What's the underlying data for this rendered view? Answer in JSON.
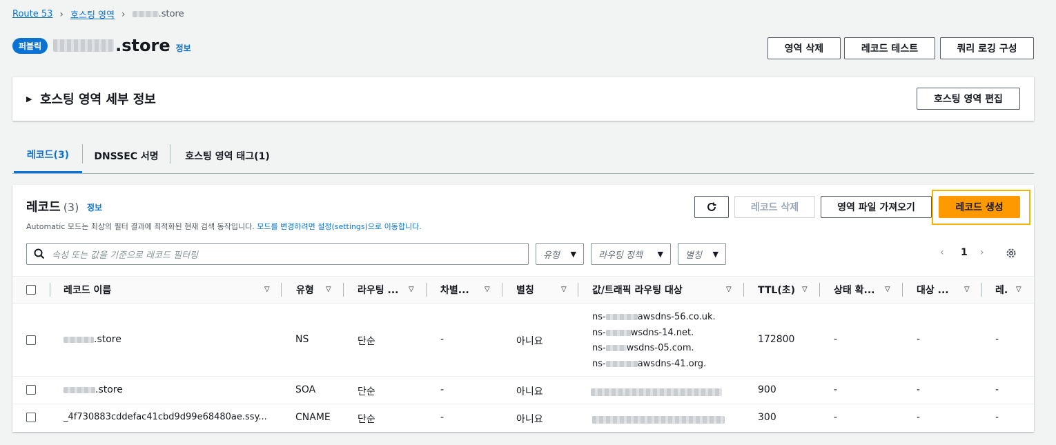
{
  "breadcrumb": {
    "root": "Route 53",
    "section": "호스팅 영역",
    "current_suffix": ".store"
  },
  "header": {
    "badge": "퍼블릭",
    "title_suffix": ".store",
    "info": "정보",
    "buttons": {
      "delete_zone": "영역 삭제",
      "test_record": "레코드 테스트",
      "query_logging": "쿼리 로깅 구성"
    }
  },
  "details": {
    "title": "호스팅 영역 세부 정보",
    "edit_button": "호스팅 영역 편집"
  },
  "tabs": [
    {
      "label": "레코드(3)",
      "active": true
    },
    {
      "label": "DNSSEC 서명",
      "active": false
    },
    {
      "label": "호스팅 영역 태그(1)",
      "active": false
    }
  ],
  "records": {
    "title": "레코드",
    "count": "(3)",
    "info": "정보",
    "desc_prefix": "Automatic 모드는 최상의 필터 결과에 최적화된 현재 검색 동작입니다. ",
    "desc_link": "모드를 변경하려면 설정(settings)으로 이동합니다.",
    "buttons": {
      "delete": "레코드 삭제",
      "import": "영역 파일 가져오기",
      "create": "레코드 생성"
    },
    "search_placeholder": "속성 또는 값을 기준으로 레코드 필터링",
    "filters": {
      "type": "유형",
      "routing": "라우팅 정책",
      "alias": "별칭"
    },
    "page": "1",
    "columns": [
      "레코드 이름",
      "유형",
      "라우팅 ...",
      "차별...",
      "별칭",
      "값/트래픽 라우팅 대상",
      "TTL(초)",
      "상태 확...",
      "대상 ...",
      "레."
    ],
    "rows": [
      {
        "name_suffix": ".store",
        "type": "NS",
        "routing": "단순",
        "diff": "-",
        "alias": "아니요",
        "values": [
          "ns-",
          "awsdns-56.co.uk.",
          "ns-",
          "wsdns-14.net.",
          "ns-",
          "wsdns-05.com.",
          "ns-",
          "awsdns-41.org."
        ],
        "ttl": "172800",
        "health": "-",
        "target": "-",
        "last": "-"
      },
      {
        "name_suffix": ".store",
        "type": "SOA",
        "routing": "단순",
        "diff": "-",
        "alias": "아니요",
        "ttl": "900",
        "health": "-",
        "target": "-",
        "last": "-"
      },
      {
        "name": "_4f730883cddefac41cbd9d99e68480ae.ssy...",
        "type": "CNAME",
        "routing": "단순",
        "diff": "-",
        "alias": "아니요",
        "ttl": "300",
        "health": "-",
        "target": "-",
        "last": "-"
      }
    ]
  },
  "colors": {
    "link": "#0972d3",
    "primary": "#ff9900",
    "highlight": "#f5b400"
  }
}
